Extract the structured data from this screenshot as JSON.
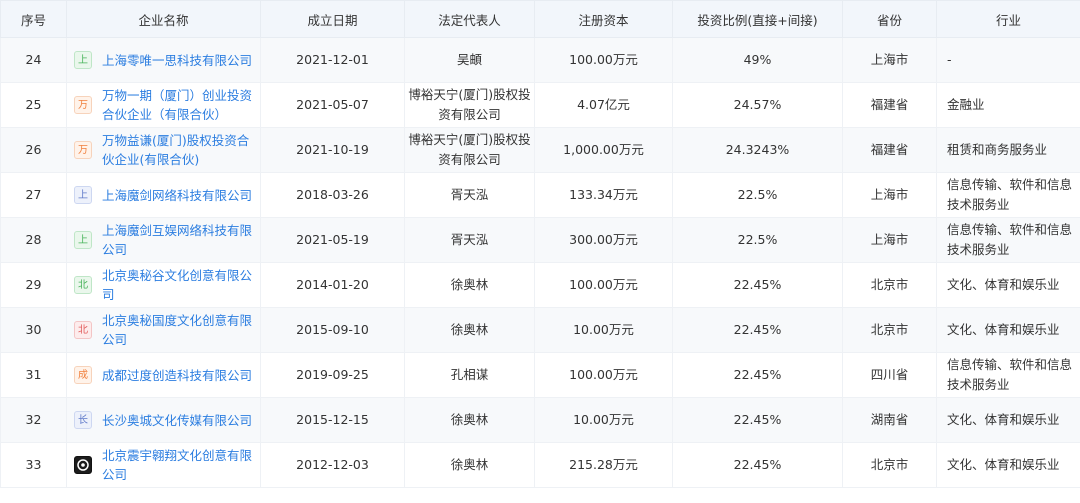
{
  "headers": [
    "序号",
    "企业名称",
    "成立日期",
    "法定代表人",
    "注册资本",
    "投资比例(直接+间接)",
    "省份",
    "行业"
  ],
  "rows": [
    {
      "no": "24",
      "badge": "上",
      "badge_color": "green",
      "name": "上海零唯一思科技有限公司",
      "date": "2021-12-01",
      "rep": "吴頔",
      "capital": "100.00万元",
      "ratio": "49%",
      "province": "上海市",
      "industry": "-"
    },
    {
      "no": "25",
      "badge": "万",
      "badge_color": "orange",
      "name": "万物一期（厦门）创业投资合伙企业（有限合伙）",
      "date": "2021-05-07",
      "rep": "博裕天宁(厦门)股权投资有限公司",
      "capital": "4.07亿元",
      "ratio": "24.57%",
      "province": "福建省",
      "industry": "金融业"
    },
    {
      "no": "26",
      "badge": "万",
      "badge_color": "orange",
      "name": "万物益谦(厦门)股权投资合伙企业(有限合伙)",
      "date": "2021-10-19",
      "rep": "博裕天宁(厦门)股权投资有限公司",
      "capital": "1,000.00万元",
      "ratio": "24.3243%",
      "province": "福建省",
      "industry": "租赁和商务服务业"
    },
    {
      "no": "27",
      "badge": "上",
      "badge_color": "blue",
      "name": "上海魔剑网络科技有限公司",
      "date": "2018-03-26",
      "rep": "胥天泓",
      "capital": "133.34万元",
      "ratio": "22.5%",
      "province": "上海市",
      "industry": "信息传输、软件和信息技术服务业"
    },
    {
      "no": "28",
      "badge": "上",
      "badge_color": "green",
      "name": "上海魔剑互娱网络科技有限公司",
      "date": "2021-05-19",
      "rep": "胥天泓",
      "capital": "300.00万元",
      "ratio": "22.5%",
      "province": "上海市",
      "industry": "信息传输、软件和信息技术服务业"
    },
    {
      "no": "29",
      "badge": "北",
      "badge_color": "green",
      "name": "北京奥秘谷文化创意有限公司",
      "date": "2014-01-20",
      "rep": "徐奥林",
      "capital": "100.00万元",
      "ratio": "22.45%",
      "province": "北京市",
      "industry": "文化、体育和娱乐业"
    },
    {
      "no": "30",
      "badge": "北",
      "badge_color": "red",
      "name": "北京奥秘国度文化创意有限公司",
      "date": "2015-09-10",
      "rep": "徐奥林",
      "capital": "10.00万元",
      "ratio": "22.45%",
      "province": "北京市",
      "industry": "文化、体育和娱乐业"
    },
    {
      "no": "31",
      "badge": "成",
      "badge_color": "orange",
      "name": "成都过度创造科技有限公司",
      "date": "2019-09-25",
      "rep": "孔相谋",
      "capital": "100.00万元",
      "ratio": "22.45%",
      "province": "四川省",
      "industry": "信息传输、软件和信息技术服务业"
    },
    {
      "no": "32",
      "badge": "长",
      "badge_color": "blue",
      "name": "长沙奥城文化传媒有限公司",
      "date": "2015-12-15",
      "rep": "徐奥林",
      "capital": "10.00万元",
      "ratio": "22.45%",
      "province": "湖南省",
      "industry": "文化、体育和娱乐业"
    },
    {
      "no": "33",
      "badge": "",
      "badge_color": "dark",
      "name": "北京震宇翱翔文化创意有限公司",
      "date": "2012-12-03",
      "rep": "徐奥林",
      "capital": "215.28万元",
      "ratio": "22.45%",
      "province": "北京市",
      "industry": "文化、体育和娱乐业"
    }
  ]
}
